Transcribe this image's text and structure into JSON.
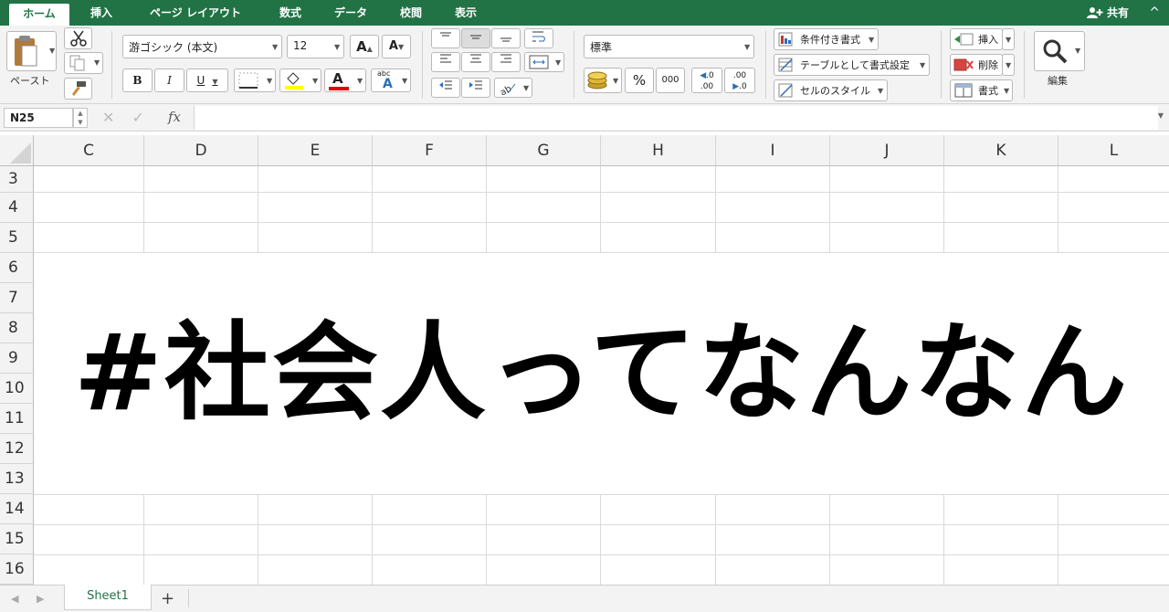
{
  "ribbon_tabs": [
    "ホーム",
    "挿入",
    "ページ レイアウト",
    "数式",
    "データ",
    "校閲",
    "表示"
  ],
  "share_label": "共有",
  "collapse_glyph": "^",
  "clipboard": {
    "paste_label": "ペースト"
  },
  "font": {
    "name": "游ゴシック (本文)",
    "size": "12",
    "bold": "B",
    "italic": "I",
    "underline": "U",
    "grow": "A",
    "shrink": "A",
    "color_letter": "A",
    "phonetic_top": "abc",
    "phonetic_letter": "A"
  },
  "number": {
    "format": "標準",
    "percent": "%",
    "comma": "000",
    "inc_decimal": ".00",
    "dec_decimal": ".0"
  },
  "styles": {
    "conditional": "条件付き書式",
    "table": "テーブルとして書式設定",
    "cell": "セルのスタイル"
  },
  "cells_group": {
    "insert": "挿入",
    "delete": "削除",
    "format": "書式"
  },
  "editing": {
    "label": "編集"
  },
  "formula_bar": {
    "name_box": "N25",
    "fx": "fx",
    "value": ""
  },
  "columns": [
    "C",
    "D",
    "E",
    "F",
    "G",
    "H",
    "I",
    "J",
    "K",
    "L"
  ],
  "rows": [
    "3",
    "4",
    "5",
    "6",
    "7",
    "8",
    "9",
    "10",
    "11",
    "12",
    "13",
    "14",
    "15",
    "16"
  ],
  "merged_cell_text": "#社会人ってなんなん",
  "sheets": [
    "Sheet1"
  ],
  "add_sheet": "+",
  "colors": {
    "accent": "#217346",
    "fill_swatch": "#ffff00",
    "font_swatch": "#e00000"
  }
}
